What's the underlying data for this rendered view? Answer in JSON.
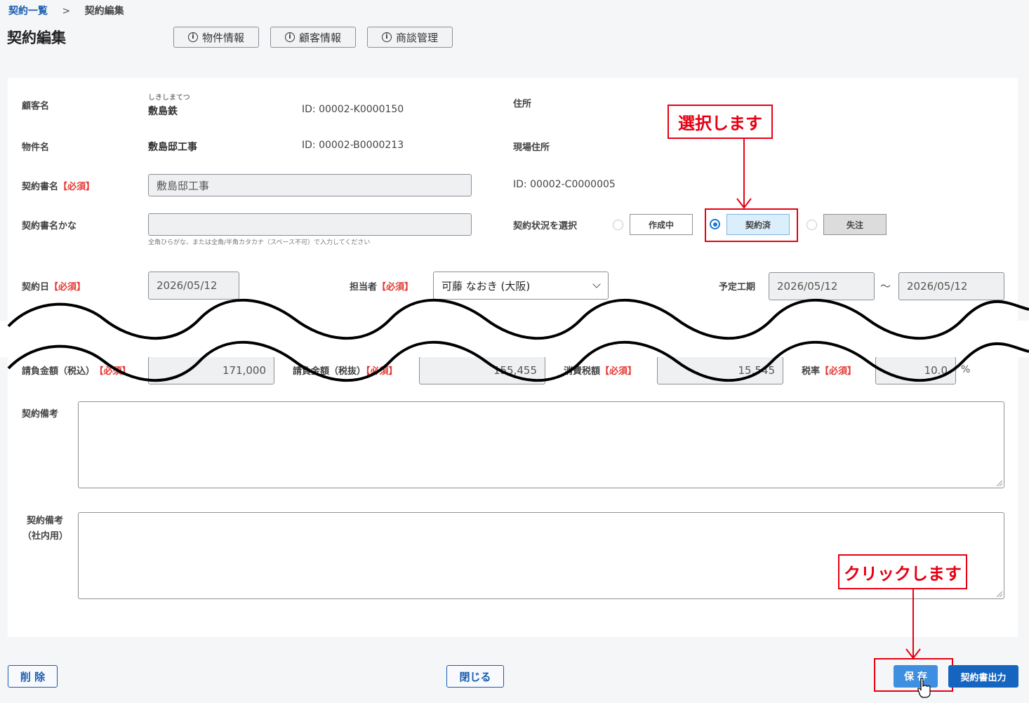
{
  "breadcrumb": {
    "root": "契約一覧",
    "sep": ">",
    "current": "契約編集"
  },
  "page_title": "契約編集",
  "top_buttons": [
    {
      "label": "物件情報",
      "icon": "info-icon"
    },
    {
      "label": "顧客情報",
      "icon": "info-icon"
    },
    {
      "label": "商談管理",
      "icon": "info-icon"
    }
  ],
  "customer": {
    "label": "顧客名",
    "kana": "しきしまてつ",
    "name": "敷島鉄",
    "id": "ID: 00002-K0000150"
  },
  "address": {
    "label": "住所"
  },
  "property": {
    "label": "物件名",
    "name": "敷島邸工事",
    "id": "ID: 00002-B0000213"
  },
  "site_address": {
    "label": "現場住所"
  },
  "contract_name": {
    "label": "契約書名",
    "required": "【必須】",
    "value": "敷島邸工事",
    "id": "ID: 00002-C0000005"
  },
  "contract_kana": {
    "label": "契約書名かな",
    "value": "",
    "hint": "全角ひらがな、または全角/半角カタカナ（スペース不可）で入力してください"
  },
  "status": {
    "label": "契約状況を選択",
    "options": [
      {
        "label": "作成中",
        "selected": false
      },
      {
        "label": "契約済",
        "selected": true
      },
      {
        "label": "失注",
        "selected": false
      }
    ]
  },
  "contract_date": {
    "label": "契約日",
    "required": "【必須】",
    "value": "2026/05/12"
  },
  "person": {
    "label": "担当者",
    "required": "【必須】",
    "value": "可藤 なおき (大阪)"
  },
  "schedule": {
    "label": "予定工期",
    "from": "2026/05/12",
    "sep": "～",
    "to": "2026/05/12"
  },
  "amounts": {
    "total_label": "請負金額（税込）",
    "total_value": "171,000",
    "net_label": "請負金額（税抜）",
    "net_value": "155,455",
    "tax_label": "消費税額",
    "tax_value": "15,545",
    "rate_label": "税率",
    "rate_value": "10.0",
    "rate_unit": "%",
    "required": "【必須】"
  },
  "remarks": {
    "label": "契約備考"
  },
  "remarks_internal": {
    "label_line1": "契約備考",
    "label_line2": "（社内用）"
  },
  "annotations": {
    "select": "選択します",
    "click": "クリックします"
  },
  "footer": {
    "delete": "削 除",
    "close": "閉じる",
    "save": "保 存",
    "output": "契約書出力"
  },
  "colors": {
    "accent": "#1565c0",
    "required": "#e53935",
    "annotation": "#e60012",
    "selected_status_bg": "#dbeefc",
    "lost_status_bg": "#dcdcdc"
  }
}
